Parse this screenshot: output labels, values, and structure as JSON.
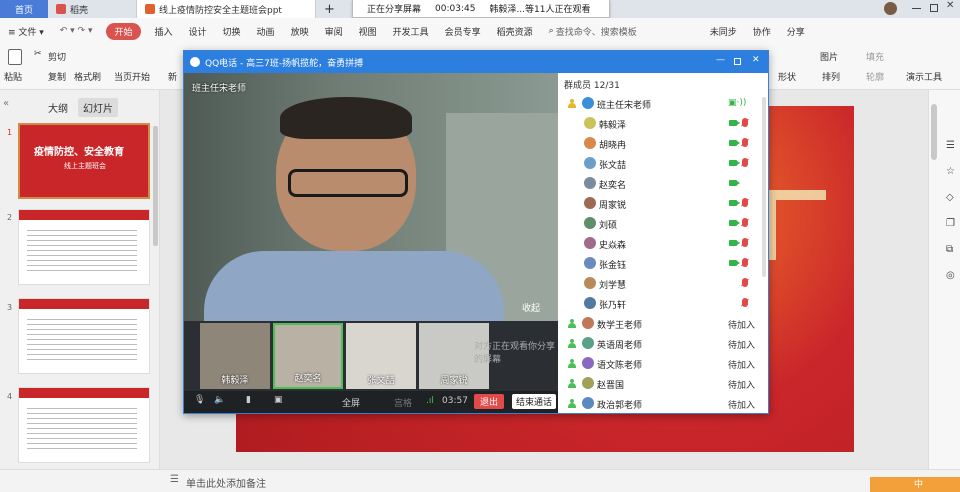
{
  "tabs": {
    "home": "首页",
    "docer": "稻壳",
    "doc": "线上疫情防控安全主题班会ppt",
    "plus": "+"
  },
  "share_banner": {
    "status": "正在分享屏幕",
    "time": "00:03:45",
    "viewers": "韩毅泽...等11人正在观看"
  },
  "menu": {
    "file": "≡ 文件 ▾",
    "start": "开始",
    "items": [
      "插入",
      "设计",
      "切换",
      "动画",
      "放映",
      "审阅",
      "视图",
      "开发工具",
      "会员专享",
      "稻壳资源"
    ],
    "search": "查找命令、搜索模板",
    "unsync": "未同步",
    "collab": "协作",
    "share": "分享"
  },
  "toolbar": {
    "paste": "粘贴",
    "cut": "剪切",
    "copy": "复制",
    "format": "格式刷",
    "from_current": "当页开始",
    "new": "新",
    "shape": "形状",
    "image": "图片",
    "fill": "填充",
    "arrange": "排列",
    "outline": "轮廓",
    "presenter": "演示工具"
  },
  "left_panel": {
    "tab_outline": "大纲",
    "tab_slides": "幻灯片",
    "slide1_title": "疫情防控、安全教育",
    "slide1_sub": "线上主题班会",
    "add": "+"
  },
  "notes": "单击此处添加备注",
  "qq": {
    "title": "QQ电话 - 高三7班-扬帆揽舵，奋勇拼搏",
    "speaker_label": "班主任宋老师",
    "collapse": "收起",
    "participants": [
      "韩毅泽",
      "赵奕名",
      "张文喆",
      "周家锐"
    ],
    "other_sharing": "对方正在观看你分享的屏幕",
    "controls": {
      "fullscreen": "全屏",
      "grid": "宫格",
      "time": "03:57",
      "leave": "退出",
      "end": "结束通话"
    },
    "members_header": "群成员 12/31",
    "members": [
      {
        "name": "班主任宋老师",
        "state": "host"
      },
      {
        "name": "韩毅泽",
        "state": "cam"
      },
      {
        "name": "胡晓冉",
        "state": "cam"
      },
      {
        "name": "张文喆",
        "state": "cam"
      },
      {
        "name": "赵奕名",
        "state": "cam-only"
      },
      {
        "name": "周家锐",
        "state": "cam"
      },
      {
        "name": "刘硕",
        "state": "cam"
      },
      {
        "name": "史焱森",
        "state": "cam"
      },
      {
        "name": "张金钰",
        "state": "cam"
      },
      {
        "name": "刘学慧",
        "state": "mic"
      },
      {
        "name": "张乃轩",
        "state": "mic"
      },
      {
        "name": "数学王老师",
        "state": "wait"
      },
      {
        "name": "英语周老师",
        "state": "wait"
      },
      {
        "name": "语文陈老师",
        "state": "wait"
      },
      {
        "name": "赵晋国",
        "state": "wait"
      },
      {
        "name": "政治郭老师",
        "state": "wait"
      }
    ],
    "wait_label": "待加入"
  },
  "colors": {
    "qq_blue": "#2c7fde",
    "slide_red": "#c9262a",
    "wps_red": "#d9534f"
  }
}
